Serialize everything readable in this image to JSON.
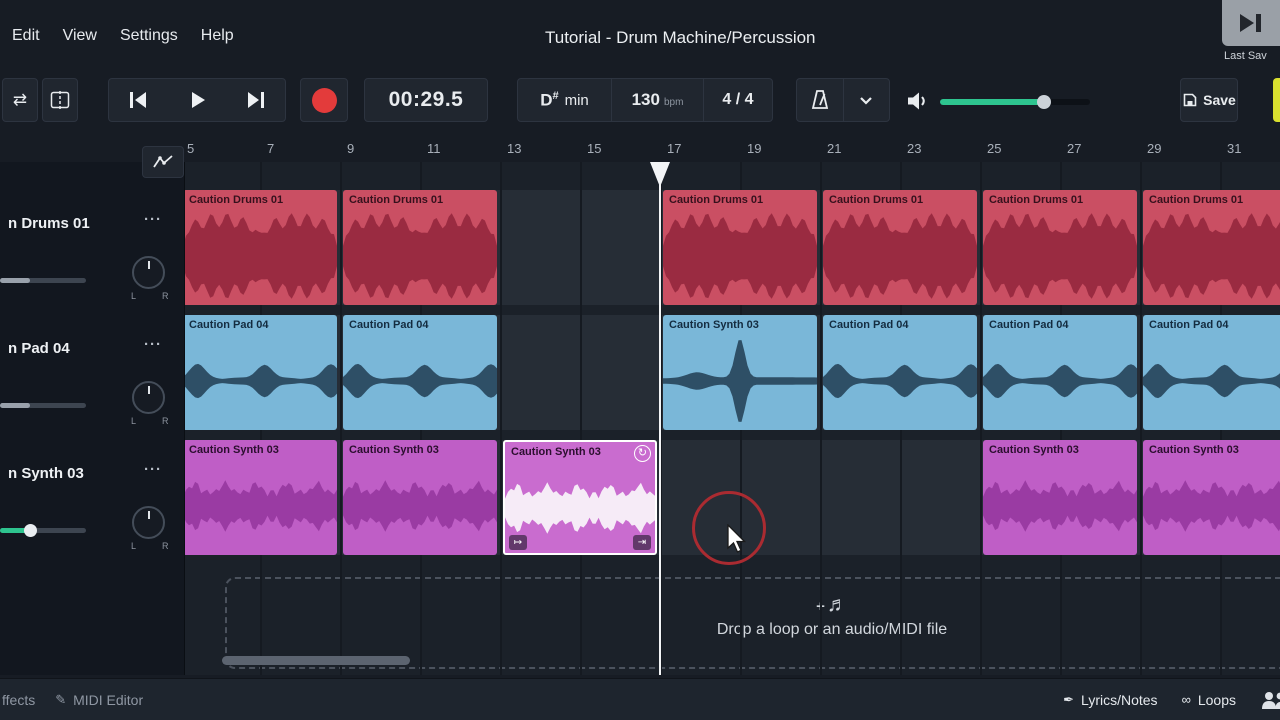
{
  "menubar": {
    "items": [
      "Edit",
      "View",
      "Settings",
      "Help"
    ],
    "title": "Tutorial - Drum Machine/Percussion"
  },
  "overlay": {
    "last_saved": "Last Sav"
  },
  "toolbar": {
    "time": "00:29.5",
    "key_root": "D",
    "key_accidental": "#",
    "key_mode": "min",
    "bpm": "130",
    "bpm_unit": "bpm",
    "time_signature": "4 / 4",
    "save": "Save"
  },
  "ruler": {
    "bars": [
      "5",
      "7",
      "9",
      "11",
      "13",
      "15",
      "17",
      "19",
      "21",
      "23",
      "25",
      "27",
      "29",
      "31"
    ]
  },
  "strings": {
    "pan_left": "L",
    "pan_right": "R"
  },
  "icons": {
    "loop": "⇄",
    "more": "···",
    "repeat": "↻",
    "fade_in": "↦",
    "fade_out": "⇥",
    "plus": "+",
    "notes": "♬",
    "pen": "✎",
    "quill": "✒",
    "infinity": "∞"
  },
  "colors": {
    "teal": "#2ec48f",
    "record_red": "#e33b3b",
    "publish_yellow": "#d9e02f",
    "drums_clip": "#ca4f63",
    "drums_wave": "#9a2b41",
    "drums_text": "#36111d",
    "pad_clip": "#7ab7d8",
    "pad_wave": "#2e4f66",
    "pad_text": "#142c40",
    "synth_clip": "#bf5ec6",
    "synth_wave": "#9a3ba3",
    "synth_text": "#2b0e2e",
    "selected_clip": "#c96ccf",
    "selected_wave": "#f6ebf7",
    "volume_gray": "#99a1ab"
  },
  "tracks": [
    {
      "name": "n Drums 01",
      "type": "drums",
      "volume_fill": 30,
      "volume_color": "#99a1ab",
      "volume_handle": false,
      "clips": [
        {
          "label": "Caution Drums 01",
          "bar": 5,
          "len": 4
        },
        {
          "label": "Caution Drums 01",
          "bar": 9,
          "len": 4
        },
        {
          "label": "Caution Drums 01",
          "bar": 17,
          "len": 4
        },
        {
          "label": "Caution Drums 01",
          "bar": 21,
          "len": 4
        },
        {
          "label": "Caution Drums 01",
          "bar": 25,
          "len": 4
        },
        {
          "label": "Caution Drums 01",
          "bar": 29,
          "len": 4
        }
      ]
    },
    {
      "name": "n Pad 04",
      "type": "pad",
      "volume_fill": 30,
      "volume_color": "#99a1ab",
      "volume_handle": false,
      "clips": [
        {
          "label": "Caution Pad 04",
          "bar": 5,
          "len": 4
        },
        {
          "label": "Caution Pad 04",
          "bar": 9,
          "len": 4
        },
        {
          "label": "Caution Synth 03",
          "bar": 17,
          "len": 4,
          "wave": "spike"
        },
        {
          "label": "Caution Pad 04",
          "bar": 21,
          "len": 4
        },
        {
          "label": "Caution Pad 04",
          "bar": 25,
          "len": 4
        },
        {
          "label": "Caution Pad 04",
          "bar": 29,
          "len": 4
        }
      ]
    },
    {
      "name": "n Synth 03",
      "type": "synth",
      "volume_fill": 30,
      "volume_color": "#2ec48f",
      "volume_handle": true,
      "clips": [
        {
          "label": "Caution Synth 03",
          "bar": 5,
          "len": 4
        },
        {
          "label": "Caution Synth 03",
          "bar": 9,
          "len": 4
        },
        {
          "label": "Caution Synth 03",
          "bar": 13,
          "len": 4,
          "selected": true
        },
        {
          "label": "Caution Synth 03",
          "bar": 25,
          "len": 4
        },
        {
          "label": "Caution Synth 03",
          "bar": 29,
          "len": 4
        }
      ]
    }
  ],
  "dropzone": {
    "text": "Drop a loop or an audio/MIDI file"
  },
  "bottombar": {
    "left": [
      {
        "label": "ffects"
      },
      {
        "label": "MIDI Editor"
      }
    ],
    "right": [
      {
        "label": "Lyrics/Notes"
      },
      {
        "label": "Loops"
      }
    ]
  }
}
